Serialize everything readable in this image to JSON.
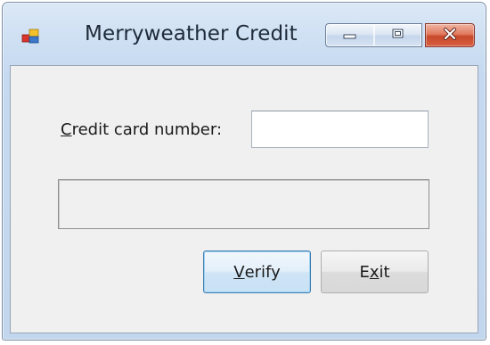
{
  "window": {
    "title": "Merryweather Credit",
    "icon": "app-form-icon",
    "controls": {
      "minimize": "minimize-icon",
      "maximize": "maximize-icon",
      "close": "close-icon"
    }
  },
  "form": {
    "credit_label_mnemonic": "C",
    "credit_label_rest": "redit card number:",
    "credit_card_value": "",
    "result_text": "",
    "verify_before": "",
    "verify_mnemonic": "V",
    "verify_after": "erify",
    "exit_before": "E",
    "exit_mnemonic": "x",
    "exit_after": "it"
  }
}
